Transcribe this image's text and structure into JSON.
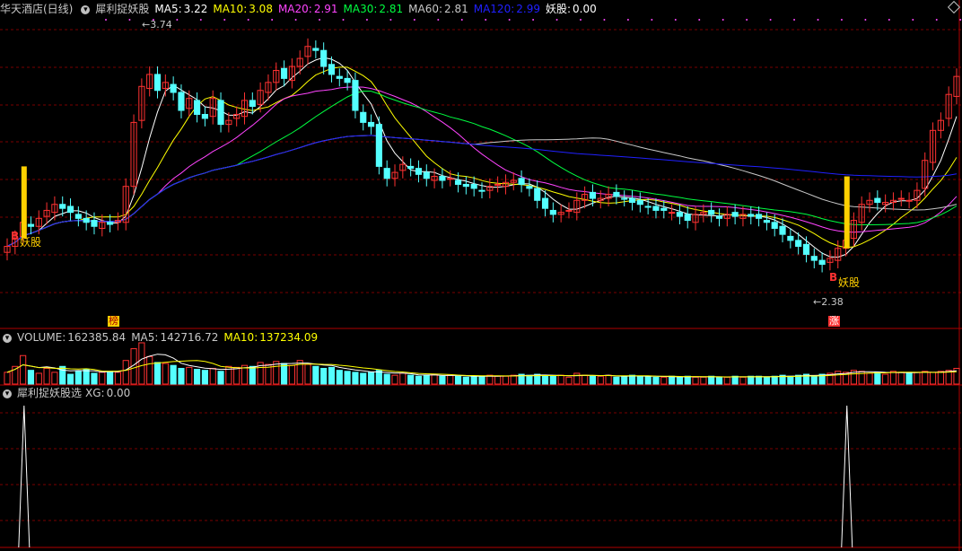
{
  "header": {
    "stock": "华天酒店(日线)",
    "indicator": "犀利捉妖股",
    "ma": [
      {
        "label": "MA5:",
        "value": "3.22",
        "color": "#ffffff"
      },
      {
        "label": "MA10:",
        "value": "3.08",
        "color": "#ffff00"
      },
      {
        "label": "MA20:",
        "value": "2.91",
        "color": "#ff44ff"
      },
      {
        "label": "MA30:",
        "value": "2.81",
        "color": "#00ff40"
      },
      {
        "label": "MA60:",
        "value": "2.81",
        "color": "#c8c8c8"
      },
      {
        "label": "MA120:",
        "value": "2.99",
        "color": "#2020ff"
      },
      {
        "label": "妖股:",
        "value": "0.00",
        "color": "#ffffff"
      }
    ]
  },
  "volume_header": {
    "label": "VOLUME:",
    "value": "162385.84",
    "ma5_label": "MA5:",
    "ma5_value": "142716.72",
    "ma10_label": "MA10:",
    "ma10_value": "137234.09"
  },
  "xg_header": {
    "indicator": "犀利捉妖股选",
    "label": "XG:",
    "value": "0.00"
  },
  "annotations": {
    "high_price": "3.74",
    "low_price": "2.38",
    "signal_text": "妖股",
    "marker_b": "B",
    "box_bang": "榜",
    "box_zhang": "涨"
  },
  "colors": {
    "up": "#ff3232",
    "down": "#54ffff",
    "grid": "#7a0000",
    "signal": "#ffd000"
  },
  "chart_data": {
    "type": "candlestick",
    "n_bars": 121,
    "price_range": [
      2.38,
      3.74
    ],
    "xg_signals_at_bar": [
      1,
      105
    ],
    "series": [
      {
        "name": "MA5",
        "value": 3.22
      },
      {
        "name": "MA10",
        "value": 3.08
      },
      {
        "name": "MA20",
        "value": 2.91
      },
      {
        "name": "MA30",
        "value": 2.81
      },
      {
        "name": "MA60",
        "value": 2.81
      },
      {
        "name": "MA120",
        "value": 2.99
      }
    ],
    "close": [
      2.62,
      2.66,
      2.74,
      2.72,
      2.76,
      2.8,
      2.83,
      2.81,
      2.79,
      2.76,
      2.74,
      2.72,
      2.74,
      2.73,
      2.75,
      2.92,
      3.24,
      3.42,
      3.48,
      3.4,
      3.44,
      3.39,
      3.3,
      3.36,
      3.28,
      3.26,
      3.36,
      3.23,
      3.25,
      3.28,
      3.35,
      3.32,
      3.4,
      3.44,
      3.5,
      3.46,
      3.52,
      3.56,
      3.62,
      3.6,
      3.52,
      3.48,
      3.46,
      3.44,
      3.3,
      3.24,
      3.22,
      3.02,
      2.96,
      2.99,
      3.03,
      3.01,
      2.98,
      2.96,
      2.97,
      2.95,
      2.96,
      2.93,
      2.92,
      2.91,
      2.9,
      2.92,
      2.93,
      2.94,
      2.95,
      2.93,
      2.91,
      2.85,
      2.81,
      2.78,
      2.79,
      2.8,
      2.85,
      2.88,
      2.86,
      2.86,
      2.88,
      2.87,
      2.86,
      2.84,
      2.83,
      2.82,
      2.8,
      2.8,
      2.79,
      2.77,
      2.75,
      2.78,
      2.79,
      2.78,
      2.76,
      2.78,
      2.77,
      2.78,
      2.77,
      2.76,
      2.74,
      2.71,
      2.68,
      2.65,
      2.62,
      2.58,
      2.55,
      2.53,
      2.56,
      2.61,
      2.65,
      2.75,
      2.83,
      2.85,
      2.84,
      2.84,
      2.85,
      2.86,
      2.85,
      2.9,
      3.05,
      3.2,
      3.25,
      3.38,
      3.47
    ],
    "volume": [
      1.2,
      1.8,
      2.9,
      1.4,
      1.1,
      1.6,
      1.2,
      1.8,
      1.0,
      1.3,
      1.5,
      1.1,
      1.2,
      1.3,
      1.2,
      2.4,
      3.6,
      4.2,
      2.8,
      2.2,
      2.1,
      1.9,
      1.6,
      1.7,
      1.5,
      1.4,
      1.6,
      1.3,
      1.8,
      1.7,
      1.9,
      1.8,
      2.2,
      2.0,
      2.3,
      2.1,
      1.9,
      2.4,
      2.0,
      1.8,
      1.6,
      1.7,
      1.4,
      1.3,
      1.2,
      1.1,
      1.2,
      1.4,
      1.0,
      0.9,
      1.1,
      0.9,
      0.8,
      0.9,
      1.0,
      0.8,
      0.9,
      0.8,
      0.7,
      0.8,
      0.8,
      0.9,
      0.8,
      0.8,
      0.9,
      1.0,
      0.9,
      1.0,
      0.8,
      0.8,
      0.9,
      0.7,
      1.1,
      0.9,
      0.8,
      0.8,
      0.9,
      0.7,
      0.8,
      0.9,
      0.8,
      0.8,
      0.7,
      0.7,
      0.8,
      0.7,
      0.8,
      0.7,
      0.7,
      0.8,
      0.7,
      0.7,
      0.8,
      0.7,
      0.8,
      0.8,
      0.7,
      0.8,
      0.9,
      0.8,
      0.9,
      1.0,
      0.8,
      1.0,
      1.1,
      1.3,
      1.2,
      1.4,
      1.3,
      1.1,
      1.2,
      1.0,
      1.3,
      1.2,
      1.1,
      1.2,
      1.3,
      1.2,
      1.3,
      1.4,
      1.6
    ]
  }
}
